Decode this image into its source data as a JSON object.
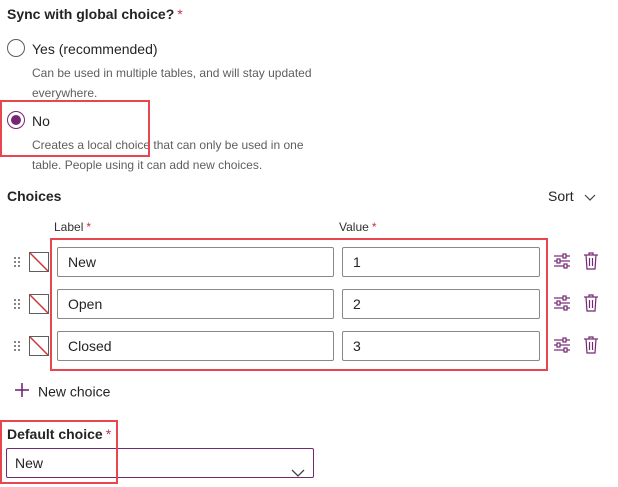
{
  "sync": {
    "title": "Sync with global choice?",
    "required_mark": "*",
    "options": [
      {
        "label": "Yes (recommended)",
        "description": "Can be used in multiple tables, and will stay updated everywhere.",
        "selected": false
      },
      {
        "label": "No",
        "description": "Creates a local choice that can only be used in one table. People using it can add new choices.",
        "selected": true
      }
    ]
  },
  "choices": {
    "heading": "Choices",
    "sort_label": "Sort",
    "label_header": "Label",
    "value_header": "Value",
    "required_mark": "*",
    "rows": [
      {
        "label": "New",
        "value": "1"
      },
      {
        "label": "Open",
        "value": "2"
      },
      {
        "label": "Closed",
        "value": "3"
      }
    ],
    "add_label": "New choice"
  },
  "default_choice": {
    "heading": "Default choice",
    "required_mark": "*",
    "value": "New"
  },
  "colors": {
    "accent": "#742774",
    "highlight": "#e8464e",
    "required": "#c4314b"
  }
}
